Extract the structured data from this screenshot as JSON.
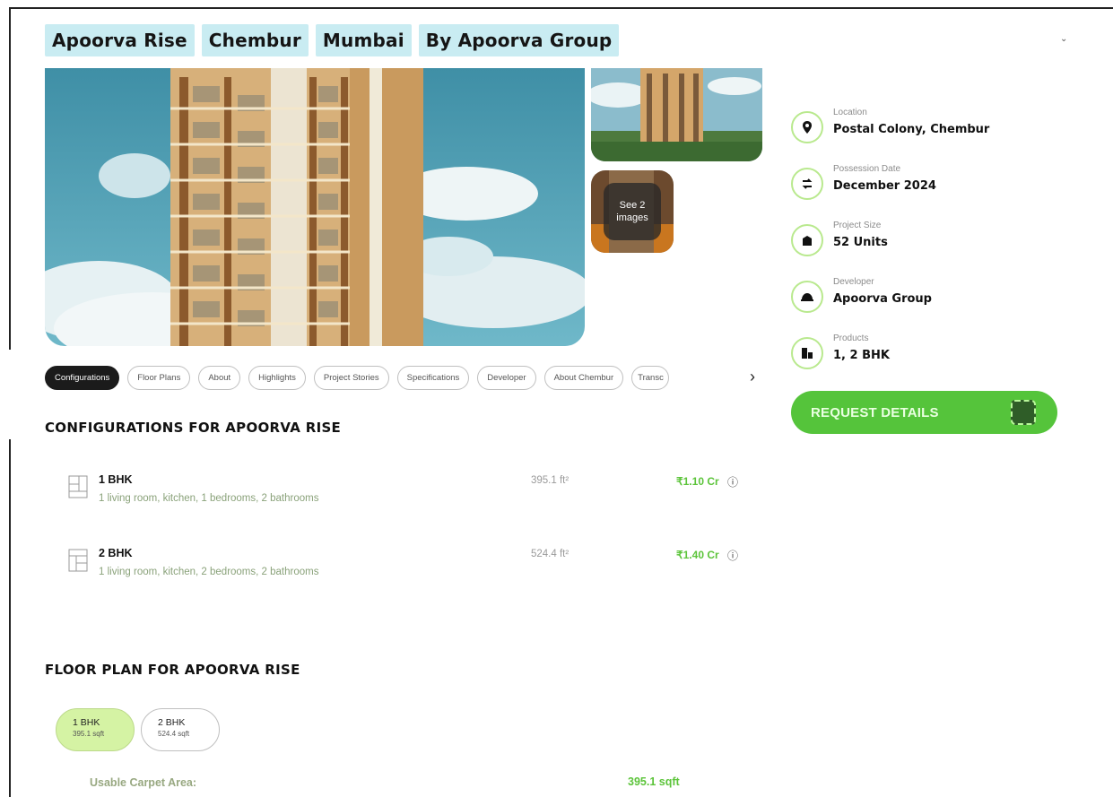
{
  "header": {
    "tags": [
      "Apoorva Rise",
      "Chembur",
      "Mumbai",
      "By Apoorva Group"
    ]
  },
  "gallery": {
    "see_more_line1": "See 2",
    "see_more_line2": "images"
  },
  "tabs": [
    "Configurations",
    "Floor Plans",
    "About",
    "Highlights",
    "Project Stories",
    "Specifications",
    "Developer",
    "About Chembur",
    "Transc"
  ],
  "configurations": {
    "title": "CONFIGURATIONS FOR APOORVA RISE",
    "rows": [
      {
        "name": "1 BHK",
        "desc": "1 living room, kitchen, 1 bedrooms, 2 bathrooms",
        "area": "395.1 ft²",
        "price": "₹1.10 Cr"
      },
      {
        "name": "2 BHK",
        "desc": "1 living room, kitchen, 2 bedrooms, 2 bathrooms",
        "area": "524.4 ft²",
        "price": "₹1.40 Cr"
      }
    ]
  },
  "floor_plan": {
    "title": "FLOOR PLAN FOR APOORVA RISE",
    "options": [
      {
        "name": "1 BHK",
        "size": "395.1 sqft"
      },
      {
        "name": "2 BHK",
        "size": "524.4 sqft"
      }
    ],
    "usable_label": "Usable Carpet Area:",
    "usable_value": "395.1 sqft"
  },
  "info": [
    {
      "label": "Location",
      "value": "Postal Colony, Chembur",
      "icon": "location-pin-icon"
    },
    {
      "label": "Possession Date",
      "value": "December 2024",
      "icon": "arrows-swap-icon"
    },
    {
      "label": "Project Size",
      "value": "52 Units",
      "icon": "building-icon"
    },
    {
      "label": "Developer",
      "value": "Apoorva Group",
      "icon": "hardhat-icon"
    },
    {
      "label": "Products",
      "value": "1, 2 BHK",
      "icon": "buildings-icon"
    }
  ],
  "cta": {
    "label": "REQUEST DETAILS"
  },
  "colors": {
    "accent": "#55c43b",
    "tag_bg": "#c9ecf2",
    "price": "#5cc43a"
  }
}
